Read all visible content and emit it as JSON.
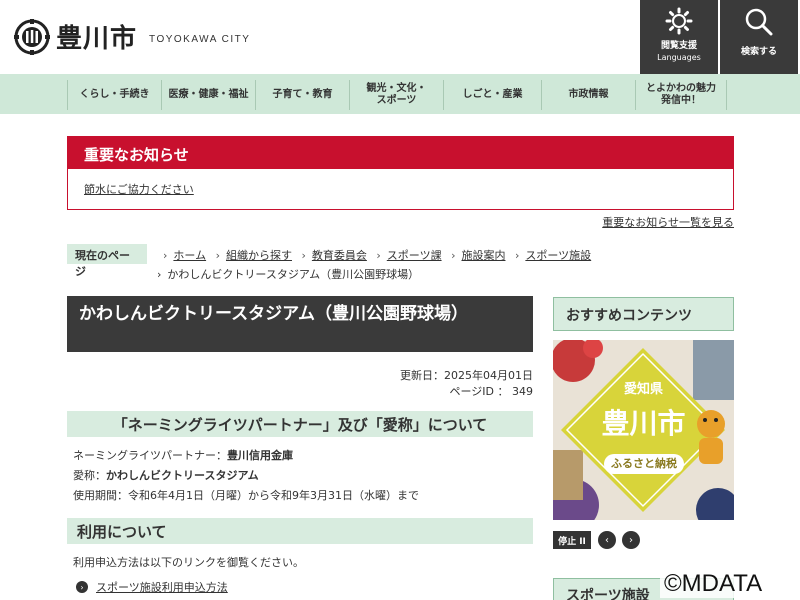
{
  "header": {
    "city_name": "豊川市",
    "city_name_en": "TOYOKAWA CITY",
    "lang_button_l1": "閲覧支援",
    "lang_button_l2": "Languages",
    "search_button": "検索する"
  },
  "nav": {
    "items": [
      {
        "label": "くらし・手続き"
      },
      {
        "label": "医療・健康・福祉"
      },
      {
        "label": "子育て・教育"
      },
      {
        "label": "観光・文化・\nスポーツ"
      },
      {
        "label": "しごと・産業"
      },
      {
        "label": "市政情報"
      },
      {
        "label": "とよかわの魅力\n発信中！"
      }
    ]
  },
  "notice": {
    "heading": "重要なお知らせ",
    "link": "節水にご協力ください",
    "all_link": "重要なお知らせ一覧を見る"
  },
  "breadcrumb": {
    "label": "現在のページ",
    "items": [
      "ホーム",
      "組織から探す",
      "教育委員会",
      "スポーツ課",
      "施設案内",
      "スポーツ施設"
    ],
    "current": "かわしんビクトリースタジアム（豊川公園野球場）"
  },
  "main": {
    "title": "かわしんビクトリースタジアム（豊川公園野球場）",
    "updated": "更新日：2025年04月01日",
    "page_id": "ページID ： 349",
    "naming_heading": "「ネーミングライツパートナー」及び「愛称」について",
    "partner_label": "ネーミングライツパートナー：",
    "partner_value": "豊川信用金庫",
    "nickname_label": "愛称：",
    "nickname_value": "かわしんビクトリースタジアム",
    "period": "使用期間：令和6年4月1日（月曜）から令和9年3月31日（水曜）まで",
    "use_heading": "利用について",
    "use_text": "利用申込方法は以下のリンクを御覧ください。",
    "use_link": "スポーツ施設利用申込方法"
  },
  "side": {
    "heading": "おすすめコンテンツ",
    "banner_pref": "愛知県",
    "banner_city": "豊川市",
    "banner_tag": "ふるさと納税",
    "stop_label": "停止 II",
    "prev_icon": "chevron-left-icon",
    "next_icon": "chevron-right-icon",
    "heading2": "スポーツ施設"
  },
  "watermark": "©MDATA",
  "colors": {
    "accent_red": "#c8102e",
    "nav_green": "#cfe8d8",
    "dark": "#3a3a3a",
    "banner_yellow": "#d8d43a"
  }
}
